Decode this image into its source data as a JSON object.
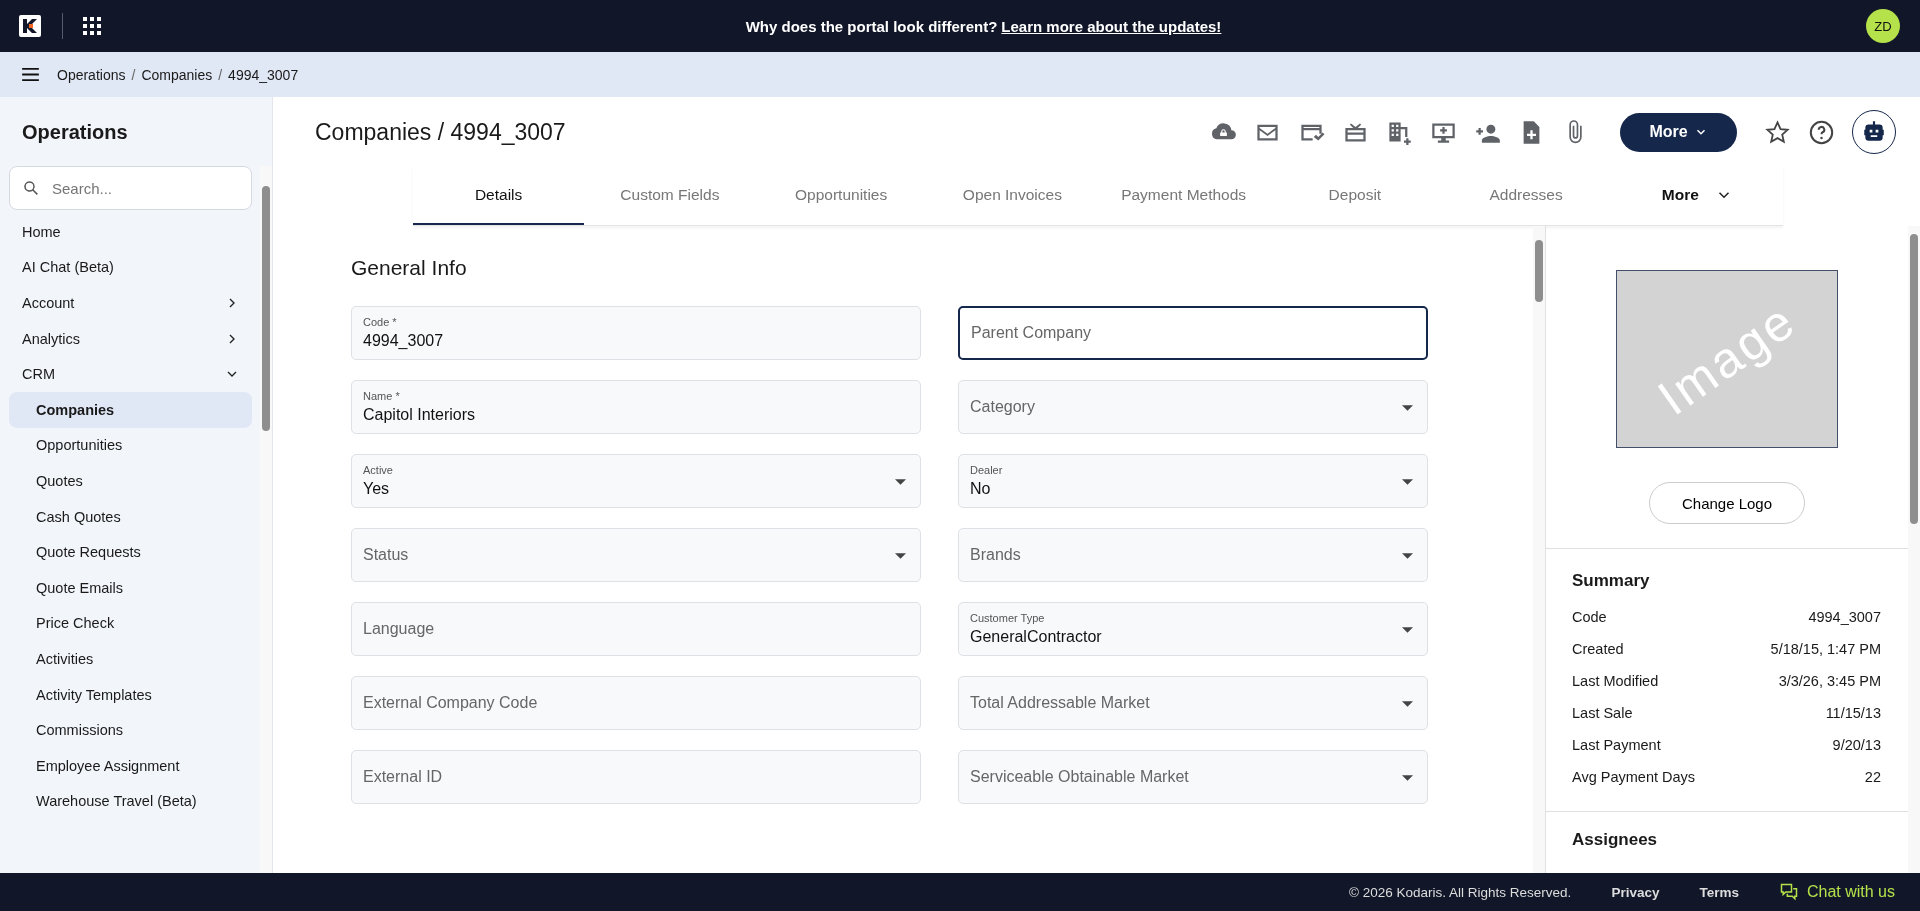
{
  "top_bar": {
    "announcement": "Why does the portal look different?",
    "announcement_link": "Learn more about the updates!",
    "avatar": "ZD"
  },
  "breadcrumb": {
    "separator": "/",
    "items": [
      "Operations",
      "Companies",
      "4994_3007"
    ]
  },
  "sidebar": {
    "title": "Operations",
    "search": {
      "placeholder": "Search..."
    },
    "items": [
      {
        "label": "Home",
        "selected": false
      },
      {
        "label": "AI Chat (Beta)",
        "selected": false
      },
      {
        "label": "Account",
        "selected": false,
        "expanded": false
      },
      {
        "label": "Analytics",
        "selected": false,
        "expanded": false
      },
      {
        "label": "CRM",
        "selected": false,
        "expanded": true,
        "children": [
          {
            "label": "Companies",
            "selected": true
          },
          {
            "label": "Opportunities",
            "selected": false
          },
          {
            "label": "Quotes",
            "selected": false
          },
          {
            "label": "Cash Quotes",
            "selected": false
          },
          {
            "label": "Quote Requests",
            "selected": false
          },
          {
            "label": "Quote Emails",
            "selected": false
          },
          {
            "label": "Price Check",
            "selected": false
          },
          {
            "label": "Activities",
            "selected": false
          },
          {
            "label": "Activity Templates",
            "selected": false
          },
          {
            "label": "Commissions",
            "selected": false
          },
          {
            "label": "Employee Assignment",
            "selected": false
          },
          {
            "label": "Warehouse Travel (Beta)",
            "selected": false
          }
        ]
      }
    ]
  },
  "page": {
    "title": "Companies / 4994_3007",
    "more_button": "More"
  },
  "tabs": [
    {
      "label": "Details",
      "selected": true
    },
    {
      "label": "Custom Fields",
      "selected": false
    },
    {
      "label": "Opportunities",
      "selected": false
    },
    {
      "label": "Open Invoices",
      "selected": false
    },
    {
      "label": "Payment Methods",
      "selected": false
    },
    {
      "label": "Deposit",
      "selected": false
    },
    {
      "label": "Addresses",
      "selected": false
    }
  ],
  "tabs_more": "More",
  "form": {
    "title": "General Info",
    "rows": [
      {
        "fields": [
          {
            "label": "Code *",
            "value": "4994_3007",
            "kind": "text",
            "focused": false
          },
          {
            "label": "Parent Company",
            "kind": "text",
            "focused": true
          }
        ]
      },
      {
        "fields": [
          {
            "label": "Name *",
            "value": "Capitol Interiors",
            "kind": "text",
            "focused": false
          },
          {
            "label": "Category",
            "kind": "select",
            "focused": false
          }
        ]
      },
      {
        "fields": [
          {
            "label": "Active",
            "value": "Yes",
            "kind": "select",
            "focused": false
          },
          {
            "label": "Dealer",
            "value": "No",
            "kind": "select",
            "focused": false
          }
        ]
      },
      {
        "fields": [
          {
            "label": "Status",
            "kind": "select",
            "focused": false
          },
          {
            "label": "Brands",
            "kind": "select",
            "focused": false
          }
        ]
      },
      {
        "fields": [
          {
            "label": "Language",
            "kind": "text",
            "focused": false
          },
          {
            "label": "Customer Type",
            "value": "GeneralContractor",
            "kind": "select",
            "focused": false
          }
        ]
      },
      {
        "fields": [
          {
            "label": "External Company Code",
            "kind": "text",
            "focused": false
          },
          {
            "label": "Total Addressable Market",
            "kind": "select",
            "focused": false
          }
        ]
      },
      {
        "fields": [
          {
            "label": "External ID",
            "kind": "text",
            "focused": false
          },
          {
            "label": "Serviceable Obtainable Market",
            "kind": "select",
            "focused": false
          }
        ]
      }
    ]
  },
  "logo": {
    "placeholder": "Image",
    "button": "Change Logo"
  },
  "summary": {
    "title": "Summary",
    "rows": [
      {
        "label": "Code",
        "value": "4994_3007"
      },
      {
        "label": "Created",
        "value": "5/18/15, 1:47 PM"
      },
      {
        "label": "Last Modified",
        "value": "3/3/26, 3:45 PM"
      },
      {
        "label": "Last Sale",
        "value": "11/15/13"
      },
      {
        "label": "Last Payment",
        "value": "9/20/13"
      },
      {
        "label": "Avg Payment Days",
        "value": "22"
      }
    ]
  },
  "assignees": {
    "title": "Assignees"
  },
  "footer": {
    "copyright": "© 2026 Kodaris. All Rights Reserved.",
    "links": [
      "Privacy",
      "Terms"
    ],
    "chat": "Chat with us"
  }
}
